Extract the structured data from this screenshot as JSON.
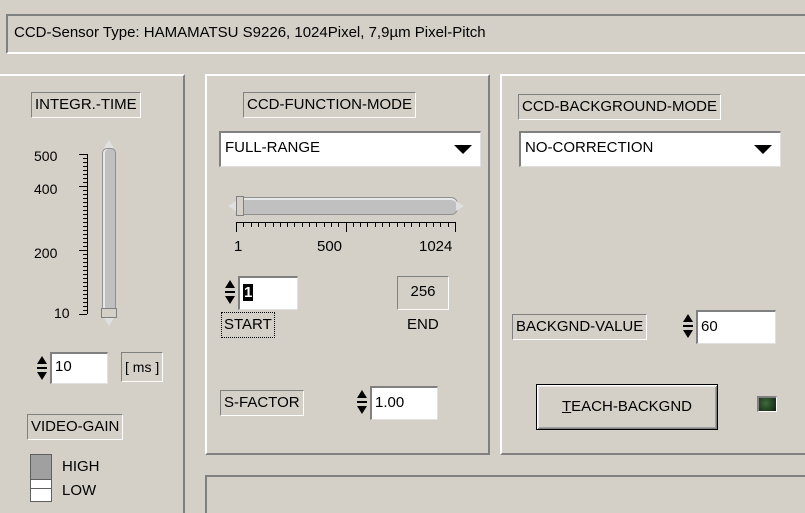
{
  "sensor_type": "CCD-Sensor Type: HAMAMATSU S9226, 1024Pixel, 7,9µm Pixel-Pitch",
  "integr": {
    "label": "INTEGR.-TIME",
    "scale": [
      "500",
      "400",
      "200",
      "10"
    ],
    "value": "10",
    "unit": "[ ms ]"
  },
  "video_gain": {
    "label": "VIDEO-GAIN",
    "options": [
      "HIGH",
      "LOW"
    ],
    "selected": "HIGH"
  },
  "function_mode": {
    "label": "CCD-FUNCTION-MODE",
    "selected": "FULL-RANGE",
    "range_ticks": [
      "1",
      "500",
      "1024"
    ],
    "start_value": "1",
    "start_label": "START",
    "end_value": "256",
    "end_label": "END",
    "s_factor_label": "S-FACTOR",
    "s_factor_value": "1.00"
  },
  "background_mode": {
    "label": "CCD-BACKGROUND-MODE",
    "selected": "NO-CORRECTION",
    "backgnd_value_label": "BACKGND-VALUE",
    "backgnd_value": "60",
    "teach_button": "TEACH-BACKGND",
    "teach_underline": "T",
    "teach_rest": "EACH-BACKGND",
    "led_color": "#1f3a1f"
  },
  "colors": {
    "window_bg": "#d4d0c8",
    "slider_fill": "#b8b8b8"
  }
}
